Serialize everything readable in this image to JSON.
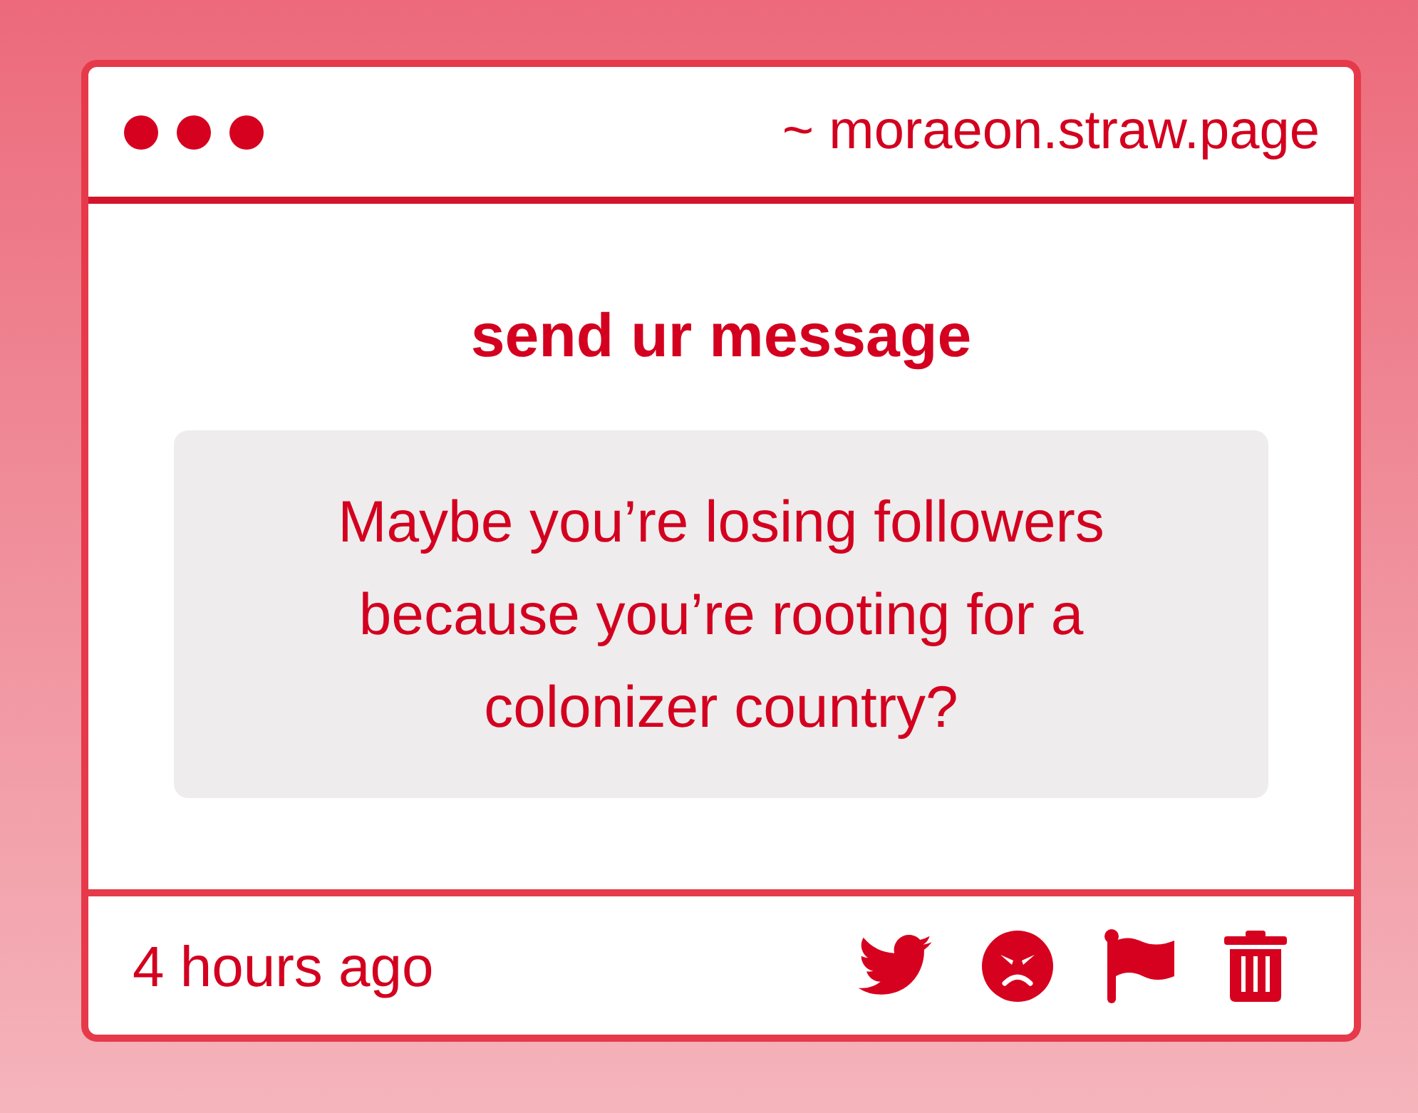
{
  "window": {
    "url": "~ moraeon.straw.page"
  },
  "heading": "send ur message",
  "message": "Maybe you’re losing followers because you’re rooting for a colonizer country?",
  "footer": {
    "time": "4 hours ago"
  }
}
